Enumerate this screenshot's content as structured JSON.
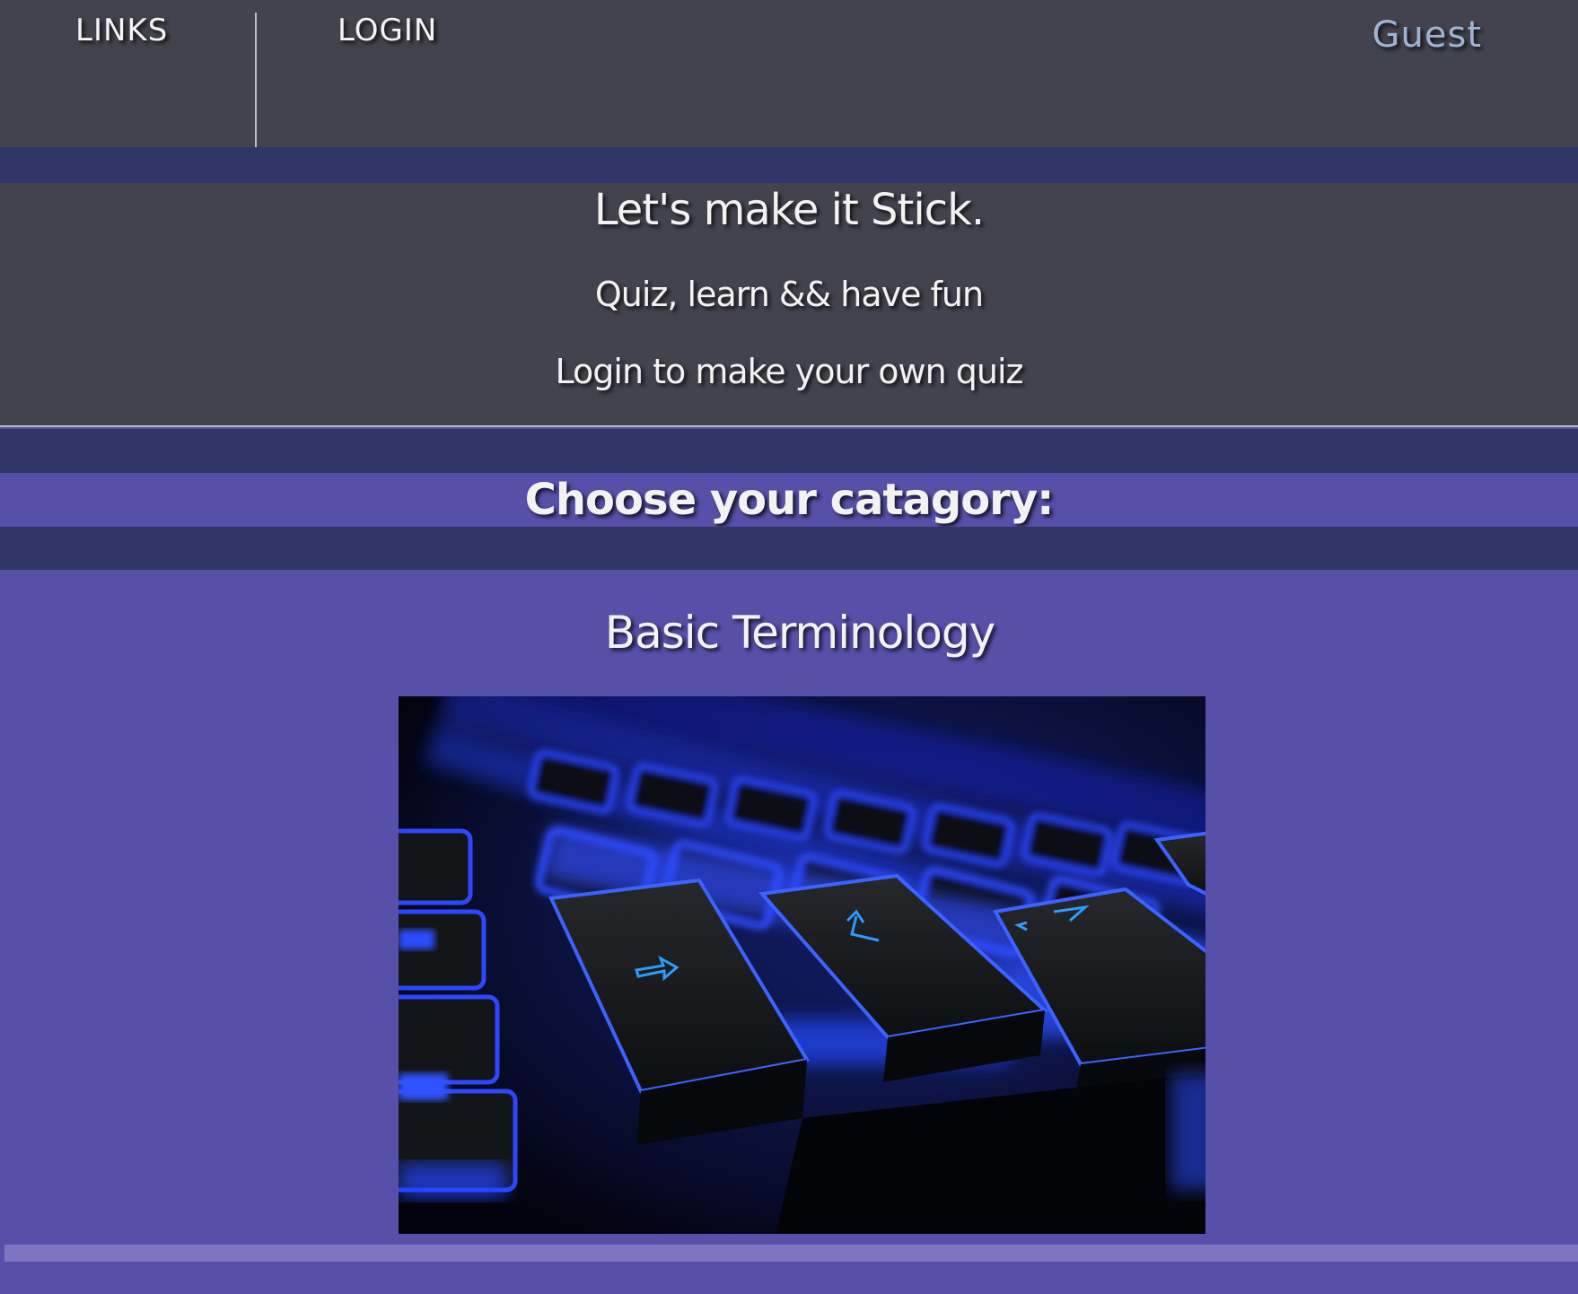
{
  "nav": {
    "links_label": "LINKS",
    "login_label": "LOGIN",
    "user_label": "Guest"
  },
  "hero": {
    "title": "Let's make it Stick.",
    "subtitle": "Quiz, learn && have fun",
    "cta": "Login to make your own quiz"
  },
  "categories_heading": "Choose your catagory:",
  "categories": [
    {
      "title": "Basic Terminology",
      "image": "glowing-blue-keyboard-photo"
    }
  ],
  "colors": {
    "nav_bg": "#43434e",
    "band_dark": "#2f3566",
    "page_bg": "#5650a9",
    "separator": "#7d75c0",
    "guest_text": "#9fb2cf"
  }
}
